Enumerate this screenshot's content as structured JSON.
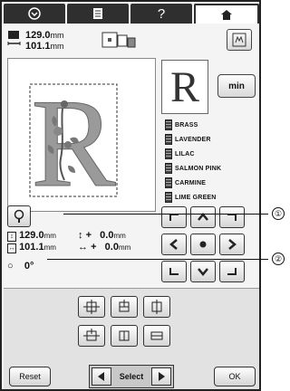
{
  "tabs": [
    {
      "name": "needle-tab",
      "icon": "needle-icon"
    },
    {
      "name": "manual-tab",
      "icon": "manual-icon"
    },
    {
      "name": "help-tab",
      "label": "?"
    },
    {
      "name": "home-tab",
      "icon": "home-icon"
    }
  ],
  "design_size": {
    "width": "129.0",
    "height": "101.1",
    "unit": "mm"
  },
  "side_letter": "R",
  "min_label": "min",
  "thread_colors": [
    "BRASS",
    "LAVENDER",
    "LILAC",
    "SALMON PINK",
    "CARMINE",
    "LIME GREEN"
  ],
  "measurements": {
    "size_h": "129.0",
    "size_w": "101.1",
    "size_unit": "mm",
    "offset_v_sign": "+",
    "offset_v": "0.0",
    "offset_h_sign": "+",
    "offset_h": "0.0",
    "offset_unit": "mm",
    "rotation": "0",
    "rotation_unit": "°"
  },
  "callouts": [
    "①",
    "②"
  ],
  "buttons": {
    "reset": "Reset",
    "ok": "OK",
    "select": "Select"
  }
}
